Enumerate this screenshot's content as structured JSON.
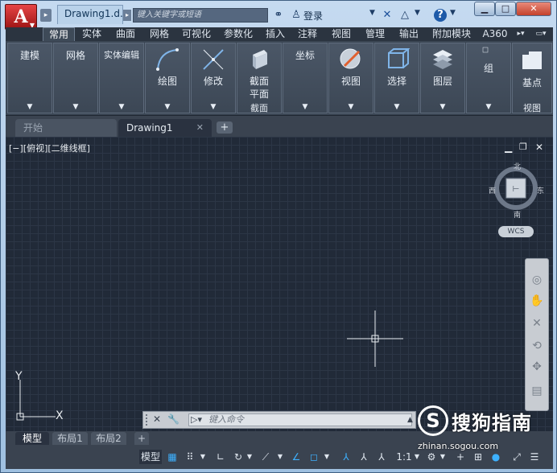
{
  "title": {
    "doc": "Drawing1.d...",
    "search_placeholder": "键入关键字或短语",
    "login": "登录",
    "help": "?"
  },
  "ribbon_tabs": [
    "常用",
    "实体",
    "曲面",
    "网格",
    "可视化",
    "参数化",
    "插入",
    "注释",
    "视图",
    "管理",
    "输出",
    "附加模块",
    "A360"
  ],
  "ribbon_panels": {
    "modeling": "建模",
    "mesh": "网格",
    "solid_edit": "实体编辑",
    "draw": "绘图",
    "modify": "修改",
    "section_line1": "截面",
    "section_line2": "平面",
    "section_footer": "截面",
    "coordinates": "坐标",
    "view": "视图",
    "selection": "选择",
    "layers": "图层",
    "groups": "组",
    "base": "基点",
    "view_footer": "视图"
  },
  "file_tabs": {
    "start": "开始",
    "drawing": "Drawing1"
  },
  "viewport": {
    "label": "[−][俯视][二维线框]",
    "compass": {
      "n": "北",
      "s": "南",
      "e": "东",
      "w": "西"
    },
    "wcs": "WCS",
    "ucs": {
      "x": "X",
      "y": "Y"
    }
  },
  "command_line": {
    "placeholder": "键入命令"
  },
  "layout_tabs": [
    "模型",
    "布局1",
    "布局2"
  ],
  "statusbar": {
    "model": "模型",
    "scale": "1:1"
  },
  "watermark": {
    "brand": "搜狗指南",
    "url": "zhinan.sogou.com",
    "logo": "S"
  },
  "colors": {
    "accent": "#3db1ff",
    "ribbon_bg": "#3b4654",
    "canvas_bg": "#212a38",
    "close_button": "#c4412c"
  }
}
